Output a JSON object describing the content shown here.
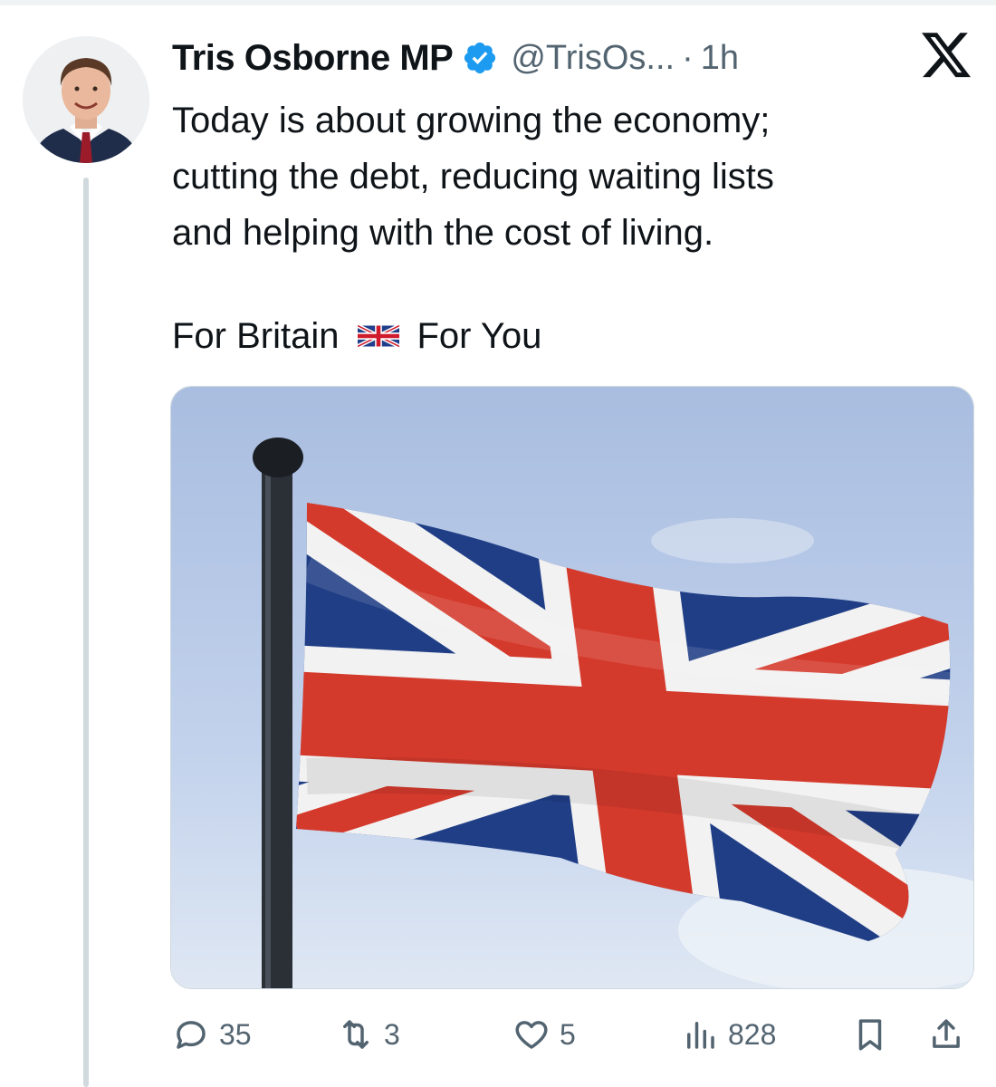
{
  "author": {
    "display_name": "Tris Osborne MP",
    "handle": "@TrisOs...",
    "separator": "·",
    "time": "1h",
    "verified": true,
    "avatar_icon": "profile-photo"
  },
  "tweet": {
    "lines": [
      "Today is about growing the economy;",
      "cutting the debt, reducing waiting lists",
      "and helping with the cost of living."
    ],
    "tagline_left": "For Britain",
    "tagline_emoji": "uk-flag-emoji",
    "tagline_right": "For You"
  },
  "media": {
    "subject_icon": "union-jack-flag-photo"
  },
  "actions": {
    "replies": "35",
    "reposts": "3",
    "likes": "5",
    "views": "828"
  },
  "colors": {
    "text_primary": "#0f1419",
    "text_secondary": "#536471",
    "verified_blue": "#1d9bf0",
    "thread_line": "#cfd9de"
  }
}
